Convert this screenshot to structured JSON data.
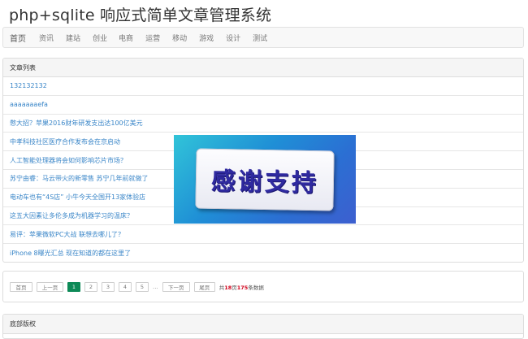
{
  "site": {
    "title": "php+sqlite 响应式简单文章管理系统"
  },
  "nav": {
    "items": [
      "首页",
      "资讯",
      "建站",
      "创业",
      "电商",
      "运营",
      "移动",
      "游戏",
      "设计",
      "测试"
    ]
  },
  "articles": {
    "heading": "文章列表",
    "items": [
      "132132132",
      "aaaaaaaefa",
      "憋大招？苹果2016财年研发支出达100亿美元",
      "中孝科技社区医疗合作发布会在京启动",
      "人工智能处理器将会如何影响芯片市场？",
      "苏宁由睿：马云带火的新零售 苏宁几年前就做了",
      "电动车也有“4S店” 小牛今天全国开13家体验店",
      "这五大因素让多伦多成为机器学习的温床？",
      "易评：苹果微软PC大战 联想去哪儿了？",
      "iPhone 8曝光汇总 现在知道的都在这里了"
    ]
  },
  "pagination": {
    "first": "首页",
    "prev": "上一页",
    "pages": [
      "1",
      "2",
      "3",
      "4",
      "5"
    ],
    "active_page": "1",
    "ellipsis": "...",
    "next": "下一页",
    "last": "尾页",
    "summary": {
      "prefix": "共",
      "pages_count": "18",
      "pages_unit": "页",
      "total_count": "175",
      "total_suffix": "条数据"
    }
  },
  "footer": {
    "heading": "底部版权"
  },
  "overlay": {
    "text": "感谢支持"
  },
  "colors": {
    "link": "#3a86c8",
    "active_page": "#0d8a57",
    "highlight": "#d0021b",
    "overlay_text": "#2f2aa0"
  }
}
